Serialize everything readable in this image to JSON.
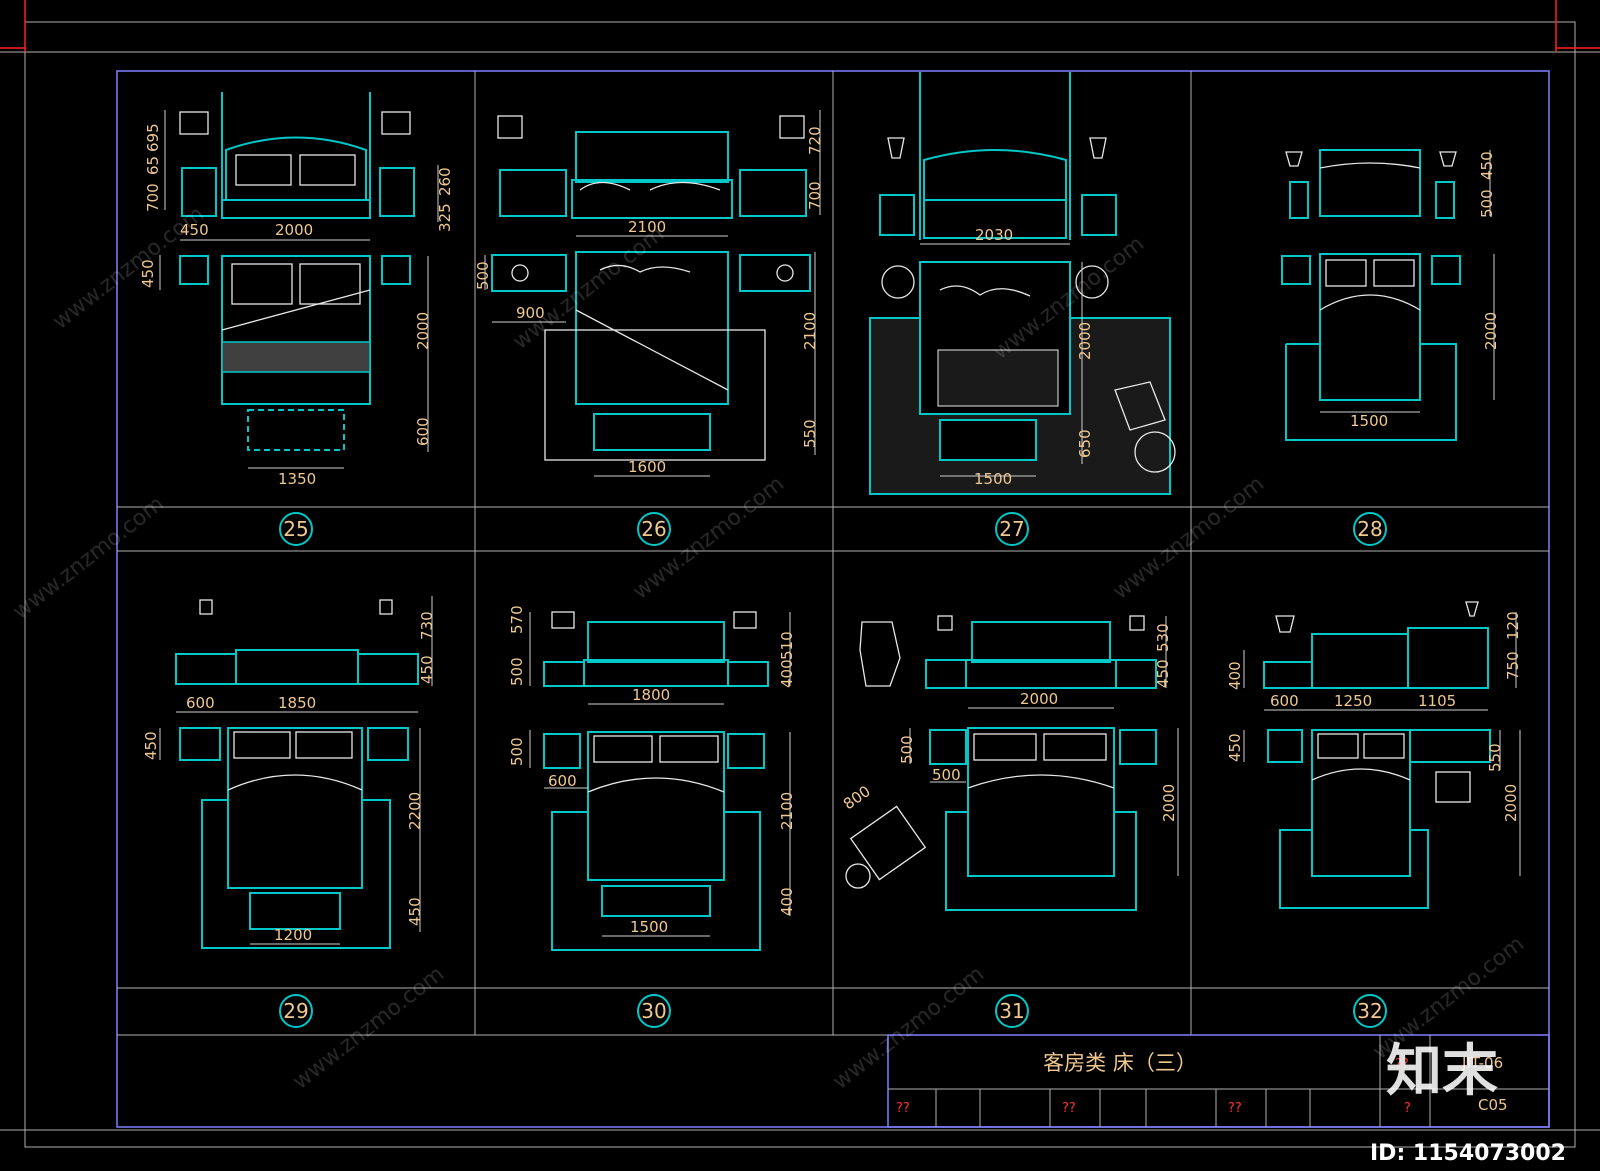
{
  "sheet": {
    "title": "客房类 床（三）",
    "drawing_code": "C05",
    "code_partial": "JIT-06",
    "title_block_marks": [
      "??",
      "??",
      "??",
      "?",
      "??"
    ]
  },
  "panels": [
    {
      "num": "25",
      "dims": [
        "700",
        "65",
        "695",
        "260",
        "325",
        "450",
        "2000",
        "450",
        "2000",
        "600",
        "1350"
      ]
    },
    {
      "num": "26",
      "dims": [
        "720",
        "700",
        "2100",
        "500",
        "900",
        "2100",
        "550",
        "1600"
      ]
    },
    {
      "num": "27",
      "dims": [
        "2030",
        "2000",
        "650",
        "1500"
      ]
    },
    {
      "num": "28",
      "dims": [
        "450",
        "500",
        "2000",
        "1500"
      ]
    },
    {
      "num": "29",
      "dims": [
        "730",
        "450",
        "600",
        "1850",
        "450",
        "2200",
        "450",
        "1200"
      ]
    },
    {
      "num": "30",
      "dims": [
        "570",
        "500",
        "510",
        "400",
        "1800",
        "500",
        "600",
        "2100",
        "400",
        "1500"
      ]
    },
    {
      "num": "31",
      "dims": [
        "530",
        "450",
        "2000",
        "500",
        "500",
        "800",
        "2000"
      ]
    },
    {
      "num": "32",
      "dims": [
        "120",
        "750",
        "400",
        "600",
        "1250",
        "1105",
        "450",
        "550",
        "2000"
      ]
    }
  ],
  "watermark": {
    "logo": "知末",
    "id_text": "ID: 1154073002",
    "site": "www.znzmo.com"
  },
  "colors": {
    "background": "#000000",
    "furniture": "#00c8c8",
    "dimension_text": "#f0c890",
    "frame": "#8080ff",
    "corner_marks": "#ff2020"
  }
}
